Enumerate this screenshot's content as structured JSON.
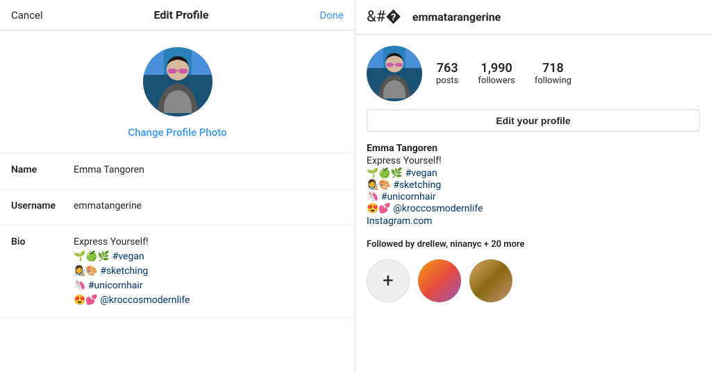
{
  "left": {
    "header": {
      "cancel": "Cancel",
      "title": "Edit Profile",
      "done": "Done"
    },
    "change_photo_label": "Change Profile Photo",
    "fields": {
      "name_label": "Name",
      "name_value": "Emma Tangoren",
      "username_label": "Username",
      "username_value": "emmatangerine",
      "bio_label": "Bio",
      "bio_lines": [
        "Express Yourself!",
        "🌱🍏🌿 #vegan",
        "👩‍🎨🎨 #sketching",
        "🦄 #unicornhair",
        "😍💕 @kroccosmodernlife"
      ]
    }
  },
  "right": {
    "header": {
      "username": "emmatarangerine"
    },
    "stats": {
      "posts_count": "763",
      "posts_label": "posts",
      "followers_count": "1,990",
      "followers_label": "followers",
      "following_count": "718",
      "following_label": "following"
    },
    "edit_profile_btn": "Edit your profile",
    "bio": {
      "fullname": "Emma Tangoren",
      "express": "Express Yourself!",
      "line1": "🌱🍏🌿 #vegan",
      "line2": "👩‍🎨🎨 #sketching",
      "line3": "🦄 #unicornhair",
      "line4": "😍💕 @kroccosmodernlife",
      "link": "Instagram.com"
    },
    "followed_by_prefix": "Followed by ",
    "followed_by_names": "drellew, ninanyc",
    "followed_by_suffix": " + 20 more"
  }
}
